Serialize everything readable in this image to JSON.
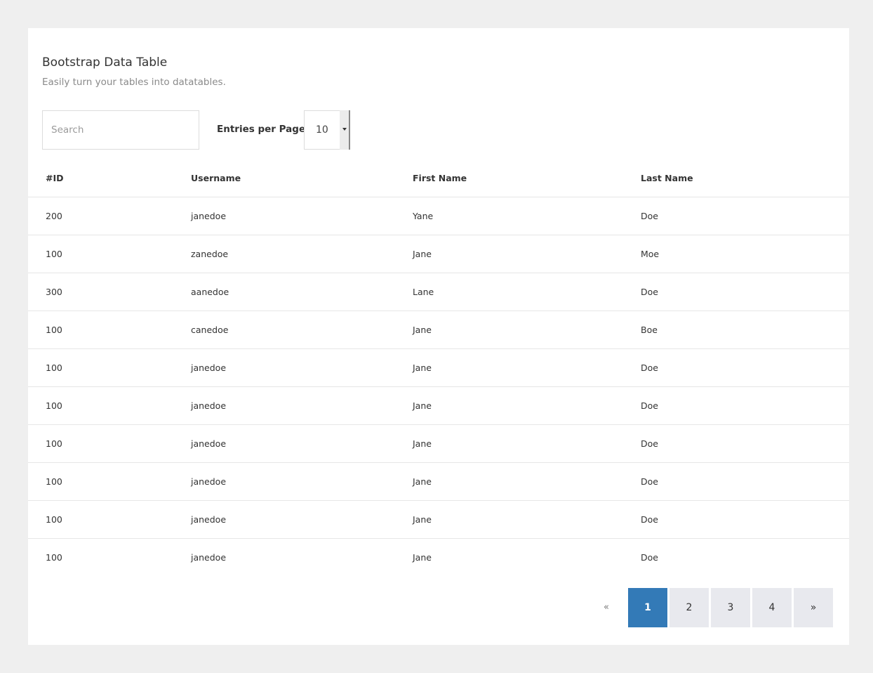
{
  "header": {
    "title": "Bootstrap Data Table",
    "subtitle": "Easily turn your tables into datatables."
  },
  "controls": {
    "search_placeholder": "Search",
    "entries_label": "Entries per Page:",
    "entries_value": "10"
  },
  "table": {
    "columns": [
      "#ID",
      "Username",
      "First Name",
      "Last Name"
    ],
    "rows": [
      [
        "200",
        "janedoe",
        "Yane",
        "Doe"
      ],
      [
        "100",
        "zanedoe",
        "Jane",
        "Moe"
      ],
      [
        "300",
        "aanedoe",
        "Lane",
        "Doe"
      ],
      [
        "100",
        "canedoe",
        "Jane",
        "Boe"
      ],
      [
        "100",
        "janedoe",
        "Jane",
        "Doe"
      ],
      [
        "100",
        "janedoe",
        "Jane",
        "Doe"
      ],
      [
        "100",
        "janedoe",
        "Jane",
        "Doe"
      ],
      [
        "100",
        "janedoe",
        "Jane",
        "Doe"
      ],
      [
        "100",
        "janedoe",
        "Jane",
        "Doe"
      ],
      [
        "100",
        "janedoe",
        "Jane",
        "Doe"
      ]
    ]
  },
  "pagination": {
    "prev": "«",
    "pages": [
      "1",
      "2",
      "3",
      "4"
    ],
    "active_page": "1",
    "next": "»"
  },
  "colors": {
    "accent": "#337ab7",
    "page_background": "#efefef",
    "card_background": "#ffffff"
  }
}
